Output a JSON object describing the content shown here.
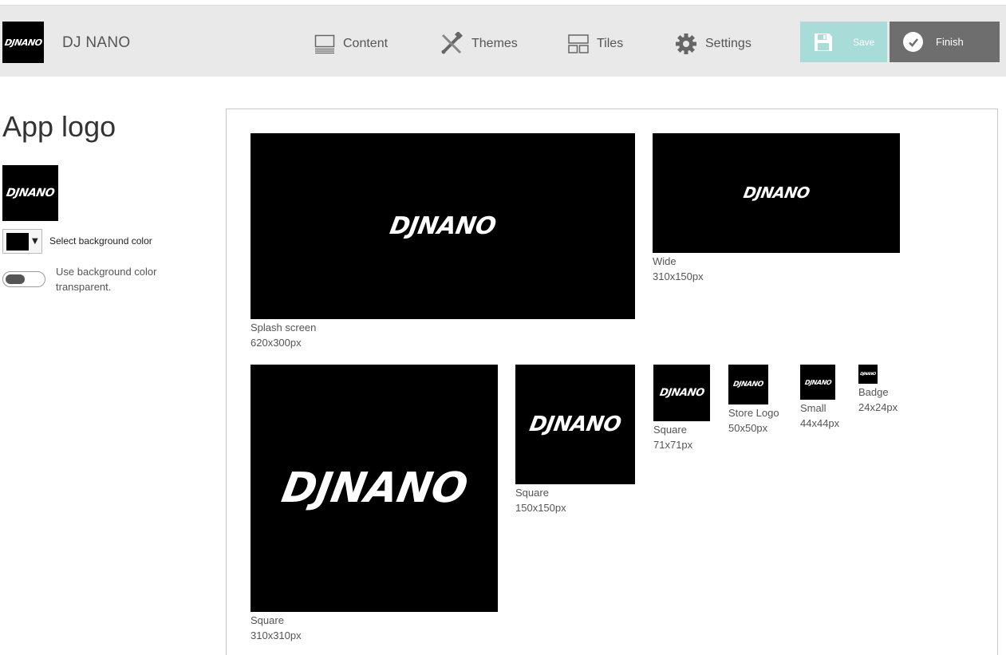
{
  "header": {
    "app_name": "DJ NANO",
    "logo_text": "DJNANO",
    "nav": [
      {
        "label": "Content",
        "icon": "content-icon"
      },
      {
        "label": "Themes",
        "icon": "themes-icon"
      },
      {
        "label": "Tiles",
        "icon": "tiles-icon"
      },
      {
        "label": "Settings",
        "icon": "gear-icon"
      }
    ],
    "save_label": "Save",
    "finish_label": "Finish"
  },
  "sidebar": {
    "title": "App logo",
    "logo_text": "DJNANO",
    "bg_color_label": "Select background color",
    "bg_color_value": "#000000",
    "transparent_label": "Use background color transparent.",
    "transparent_on": false
  },
  "previews": {
    "logo_text": "DJNANO",
    "splash": {
      "name": "Splash screen",
      "size": "620x300px"
    },
    "wide": {
      "name": "Wide",
      "size": "310x150px"
    },
    "square_large": {
      "name": "Square",
      "size": "310x310px"
    },
    "square_medium": {
      "name": "Square",
      "size": "150x150px"
    },
    "square_small": {
      "name": "Square",
      "size": "71x71px"
    },
    "store_logo": {
      "name": "Store Logo",
      "size": "50x50px"
    },
    "small": {
      "name": "Small",
      "size": "44x44px"
    },
    "badge": {
      "name": "Badge",
      "size": "24x24px"
    }
  },
  "colors": {
    "header_bg": "#e9e9e9",
    "save_bg": "#a8dcd8",
    "finish_bg": "#6e6e6e",
    "tile_bg": "#000000"
  }
}
